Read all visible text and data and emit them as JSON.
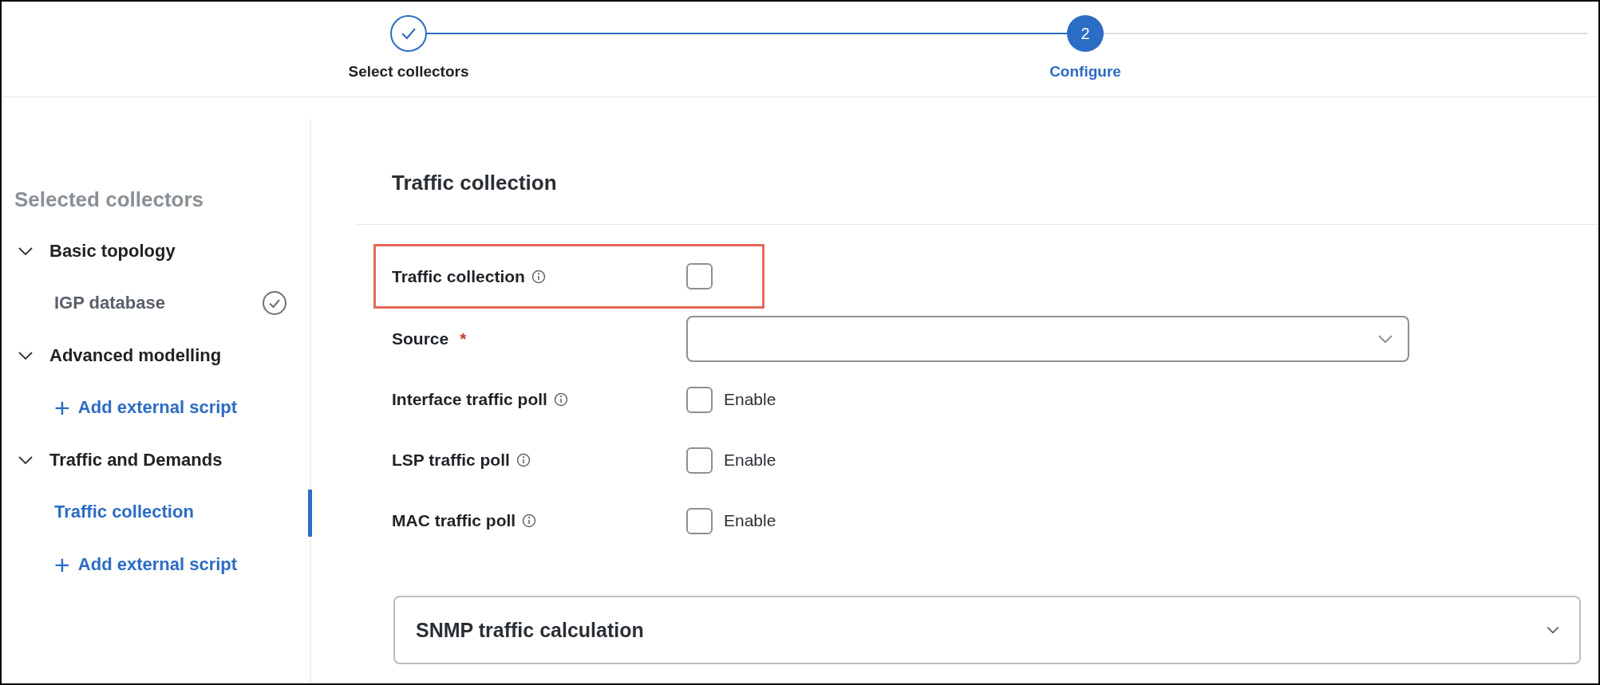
{
  "stepper": {
    "steps": [
      {
        "label": "Select collectors",
        "completed": true,
        "selected": false
      },
      {
        "label": "Configure",
        "number": "2",
        "completed": false,
        "selected": true
      }
    ]
  },
  "sidebar": {
    "title": "Selected collectors",
    "groups": [
      {
        "label": "Basic topology",
        "expanded": true,
        "children": [
          {
            "kind": "item",
            "label": "IGP database",
            "done": true,
            "selected": false
          }
        ]
      },
      {
        "label": "Advanced modelling",
        "expanded": true,
        "children": [
          {
            "kind": "add",
            "icon": "+",
            "label": "Add external script"
          }
        ]
      },
      {
        "label": "Traffic and Demands",
        "expanded": true,
        "children": [
          {
            "kind": "item",
            "label": "Traffic collection",
            "done": false,
            "selected": true
          },
          {
            "kind": "add",
            "icon": "+",
            "label": "Add external script"
          }
        ]
      }
    ]
  },
  "main": {
    "title": "Traffic collection",
    "fields": [
      {
        "kind": "checkbox",
        "label": "Traffic collection",
        "info": true,
        "checked": false,
        "highlighted": true
      },
      {
        "kind": "select",
        "label": "Source",
        "required": true,
        "required_mark": "*"
      },
      {
        "kind": "checkbox",
        "label": "Interface traffic poll",
        "info": true,
        "checked": false,
        "option": "Enable",
        "highlighted": false
      },
      {
        "kind": "checkbox",
        "label": "LSP traffic poll",
        "info": true,
        "checked": false,
        "option": "Enable",
        "highlighted": false
      },
      {
        "kind": "checkbox",
        "label": "MAC traffic poll",
        "info": true,
        "checked": false,
        "option": "Enable",
        "highlighted": false
      }
    ],
    "accordion": {
      "title": "SNMP traffic calculation",
      "expanded": false
    }
  }
}
